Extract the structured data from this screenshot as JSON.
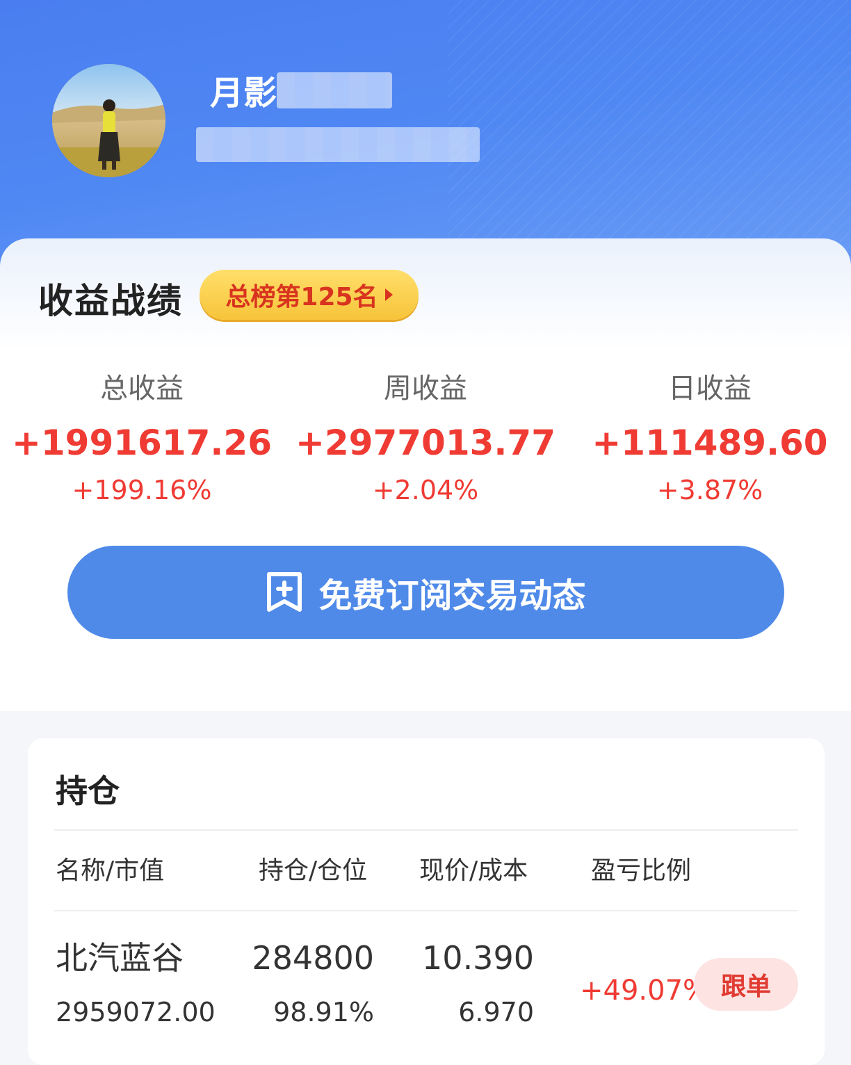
{
  "profile": {
    "username": "月影"
  },
  "performance": {
    "title": "收益战绩",
    "rank_badge": "总榜第125名",
    "stats": [
      {
        "label": "总收益",
        "value": "+1991617.26",
        "percent": "+199.16%"
      },
      {
        "label": "周收益",
        "value": "+2977013.77",
        "percent": "+2.04%"
      },
      {
        "label": "日收益",
        "value": "+111489.60",
        "percent": "+3.87%"
      }
    ],
    "subscribe_button": "免费订阅交易动态"
  },
  "holdings": {
    "title": "持仓",
    "columns": [
      "名称/市值",
      "持仓/仓位",
      "现价/成本",
      "盈亏比例"
    ],
    "rows": [
      {
        "name": "北汽蓝谷",
        "market_value": "2959072.00",
        "shares": "284800",
        "position_pct": "98.91%",
        "price": "10.390",
        "cost": "6.970",
        "pl_ratio": "+49.07%",
        "follow_label": "跟单"
      }
    ]
  },
  "colors": {
    "header_blue": "#4f87f3",
    "gain_red": "#ef3b33",
    "button_blue": "#4f8ae9",
    "badge_gold": "#f7c43a"
  }
}
